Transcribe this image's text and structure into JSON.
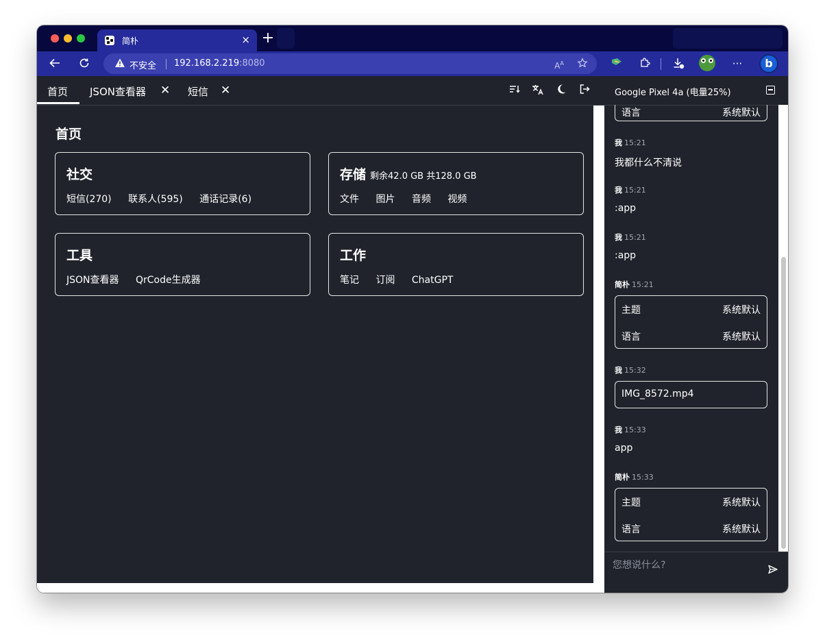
{
  "browser": {
    "tab_title": "简朴",
    "tab_close": "×",
    "new_tab": "+",
    "not_secure_label": "不安全",
    "url_host": "192.168.2.219",
    "url_port": ":8080"
  },
  "app": {
    "tabs": [
      {
        "label": "首页",
        "active": true
      },
      {
        "label": "JSON查看器",
        "close": "✕"
      },
      {
        "label": "短信",
        "close": "✕"
      }
    ],
    "page_title": "首页",
    "cards": [
      {
        "title": "社交",
        "subtitle": "",
        "links": [
          "短信(270)",
          "联系人(595)",
          "通话记录(6)"
        ]
      },
      {
        "title": "存储",
        "subtitle": "剩余42.0 GB 共128.0 GB",
        "links": [
          "文件",
          "图片",
          "音频",
          "视频"
        ]
      },
      {
        "title": "工具",
        "subtitle": "",
        "links": [
          "JSON查看器",
          "QrCode生成器"
        ]
      },
      {
        "title": "工作",
        "subtitle": "",
        "links": [
          "笔记",
          "订阅",
          "ChatGPT"
        ]
      }
    ]
  },
  "chat": {
    "device": "Google Pixel 4a (电量25%)",
    "top_partial": {
      "key": "语言",
      "value": "系统默认"
    },
    "messages": [
      {
        "sender": "我",
        "time": "15:21",
        "text": "我都什么不清说"
      },
      {
        "sender": "我",
        "time": "15:21",
        "text": ":app"
      },
      {
        "sender": "我",
        "time": "15:21",
        "text": ":app"
      },
      {
        "sender": "简朴",
        "time": "15:21",
        "rows": [
          {
            "key": "主题",
            "value": "系统默认"
          },
          {
            "key": "语言",
            "value": "系统默认"
          }
        ]
      },
      {
        "sender": "我",
        "time": "15:32",
        "file": "IMG_8572.mp4"
      },
      {
        "sender": "我",
        "time": "15:33",
        "text": "app"
      },
      {
        "sender": "简朴",
        "time": "15:33",
        "rows": [
          {
            "key": "主题",
            "value": "系统默认"
          },
          {
            "key": "语言",
            "value": "系统默认"
          }
        ]
      }
    ],
    "input_placeholder": "您想说什么?"
  },
  "colors": {
    "browser_chrome": "#252b9a",
    "titlebar": "#06083e",
    "app_background": "#20232b",
    "text": "#ffffff"
  },
  "icons": [
    "back-icon",
    "refresh-icon",
    "warning-icon",
    "read-aloud-icon",
    "favorite-icon",
    "extension-icon",
    "puzzle-icon",
    "download-icon",
    "profile-frog-icon",
    "more-icon",
    "bing-icon",
    "sort-icon",
    "translate-icon",
    "moon-icon",
    "logout-icon",
    "collapse-icon",
    "send-icon"
  ]
}
